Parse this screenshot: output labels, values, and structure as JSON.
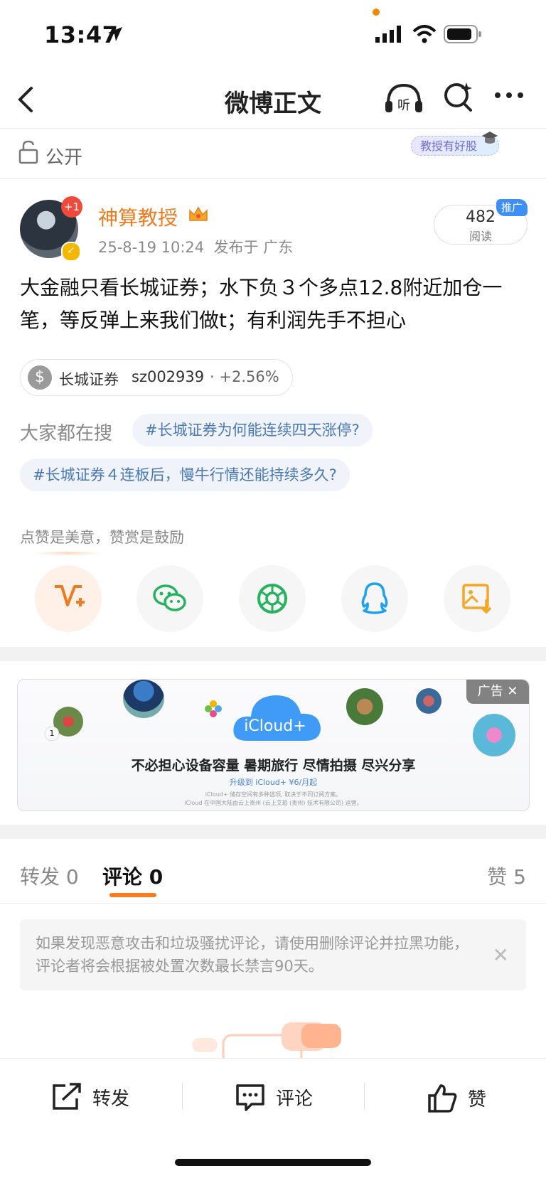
{
  "status_bar": {
    "time": "13:47"
  },
  "nav": {
    "title": "微博正文"
  },
  "visibility": {
    "label": "公开",
    "fan_badge": "教授有好股"
  },
  "author": {
    "name": "神算教授",
    "avatar_badge": "+1",
    "timestamp": "25-8-19 10:24",
    "location": "发布于 广东",
    "reads_count": "482",
    "reads_label": "阅读",
    "promo_tag": "推广"
  },
  "post": {
    "text": "大金融只看长城证券；水下负３个多点12.8附近加仓一笔，等反弹上来我们做t；有利润先手不担心"
  },
  "stock": {
    "name": "长城证券",
    "code": "sz002939",
    "change": "+2.56%"
  },
  "hot_search": {
    "label": "大家都在搜",
    "topics": [
      "#长城证券为何能连续四天涨停?",
      "#长城证券４连板后，慢牛行情还能持续多久?"
    ]
  },
  "reward": {
    "hint": "点赞是美意，赞赏是鼓励"
  },
  "share": {
    "items": [
      "reward-icon",
      "wechat-icon",
      "moments-icon",
      "qq-icon",
      "save-image-icon"
    ]
  },
  "ad": {
    "tag": "广告",
    "brand": "iCloud+",
    "headline": "不必担心设备容量 暑期旅行 尽情拍摄 尽兴分享",
    "sub": "升级到 iCloud+ ¥6/月起",
    "fine_print_1": "iCloud+ 储存空间有多种选项, 取决于不同订阅方案。",
    "fine_print_2": "iCloud 在中国大陆由云上贵州 (云上艾珀 (贵州) 技术有限公司) 运营。",
    "badge_number": "1"
  },
  "tabs": {
    "repost_label": "转发",
    "repost_count": "0",
    "comment_label": "评论",
    "comment_count": "0",
    "like_label": "赞",
    "like_count": "5"
  },
  "notice": {
    "text": "如果发现恶意攻击和垃圾骚扰评论，请使用删除评论并拉黑功能，评论者将会根据被处置次数最长禁言90天。"
  },
  "bottom_bar": {
    "repost": "转发",
    "comment": "评论",
    "like": "赞"
  },
  "colors": {
    "accent": "#ff7a1f",
    "author": "#f07a1f",
    "link": "#4a78b5"
  }
}
